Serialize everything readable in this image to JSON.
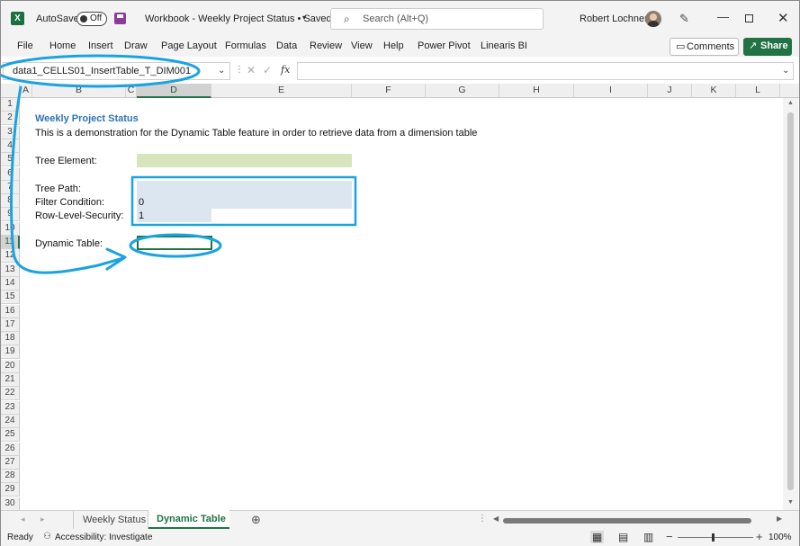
{
  "titlebar": {
    "autosave_label": "AutoSave",
    "autosave_state": "Off",
    "title": "Workbook - Weekly Project Status • Saved",
    "search_placeholder": "Search (Alt+Q)",
    "user_name": "Robert Lochner",
    "excel_icon": "excel-logo",
    "save_icon": "save-icon"
  },
  "menu": {
    "items": [
      "File",
      "Home",
      "Insert",
      "Draw",
      "Page Layout",
      "Formulas",
      "Data",
      "Review",
      "View",
      "Help",
      "Power Pivot",
      "Linearis BI"
    ],
    "comments_label": "Comments",
    "share_label": "Share"
  },
  "formula_bar": {
    "name_box": "data1_CELLS01_InsertTable_T_DIM001",
    "fx": "fx",
    "formula": ""
  },
  "columns": [
    "A",
    "B",
    "C",
    "D",
    "E",
    "F",
    "G",
    "H",
    "I",
    "J",
    "K",
    "L"
  ],
  "rows": [
    "1",
    "2",
    "3",
    "4",
    "5",
    "6",
    "7",
    "8",
    "9",
    "10",
    "11",
    "12",
    "13",
    "14",
    "15",
    "16",
    "17",
    "18",
    "19",
    "20",
    "21",
    "22",
    "23",
    "24",
    "25",
    "26",
    "27",
    "28",
    "29",
    "30"
  ],
  "sheet": {
    "title": "Weekly Project Status",
    "subtitle": "This is a demonstration for the Dynamic Table feature in order to retrieve data from a dimension table",
    "tree_element_label": "Tree Element:",
    "tree_path_label": "Tree Path:",
    "filter_condition_label": "Filter Condition:",
    "filter_condition_value": "0",
    "rls_label": "Row-Level-Security:",
    "rls_value": "1",
    "dynamic_table_label": "Dynamic Table:"
  },
  "tabs": {
    "items": [
      "Weekly Status",
      "Dynamic Table"
    ],
    "active": "Dynamic Table"
  },
  "status": {
    "ready": "Ready",
    "accessibility": "Accessibility: Investigate",
    "zoom": "100%"
  },
  "colors": {
    "accent_green": "#217346",
    "title_blue": "#2e74b5",
    "annotation_blue": "#1aa3e0",
    "input_green": "#d8e4bc",
    "output_blue": "#dce6f1"
  }
}
